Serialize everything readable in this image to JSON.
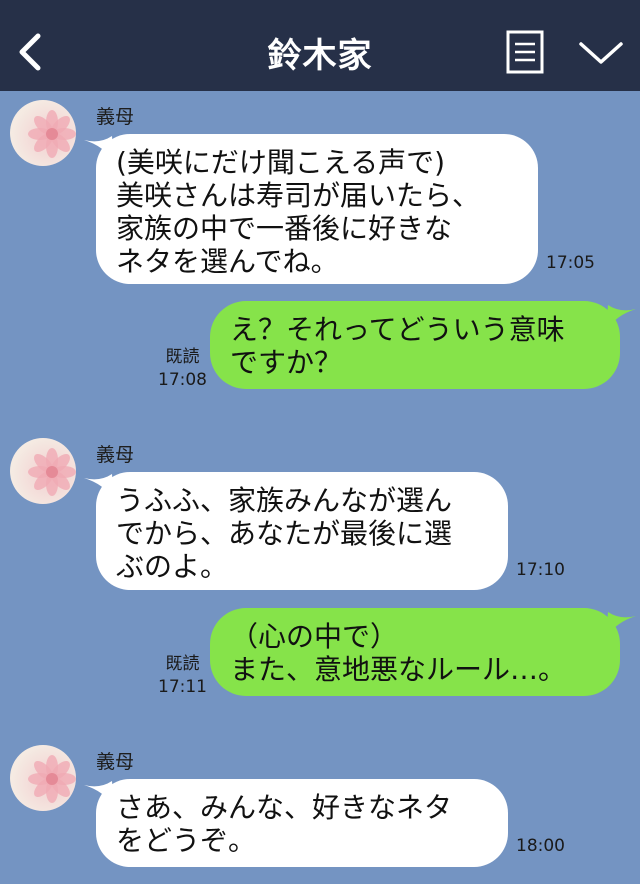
{
  "header": {
    "title": "鈴木家"
  },
  "messages": [
    {
      "sender": "義母",
      "text": "(美咲にだけ聞こえる声で)\n美咲さんは寿司が届いたら、\n家族の中で一番後に好きな\nネタを選んでね。",
      "time": "17:05"
    },
    {
      "read": "既読",
      "time": "17:08",
      "text": "え？それってどういう意味\nですか？"
    },
    {
      "sender": "義母",
      "text": "うふふ、家族みんなが選ん\nでから、あなたが最後に選\nぶのよ。",
      "time": "17:10"
    },
    {
      "read": "既読",
      "time": "17:11",
      "text": "（心の中で）\nまた、意地悪なルール…。"
    },
    {
      "sender": "義母",
      "text": "さあ、みんな、好きなネタ\nをどうぞ。",
      "time": "18:00"
    }
  ]
}
